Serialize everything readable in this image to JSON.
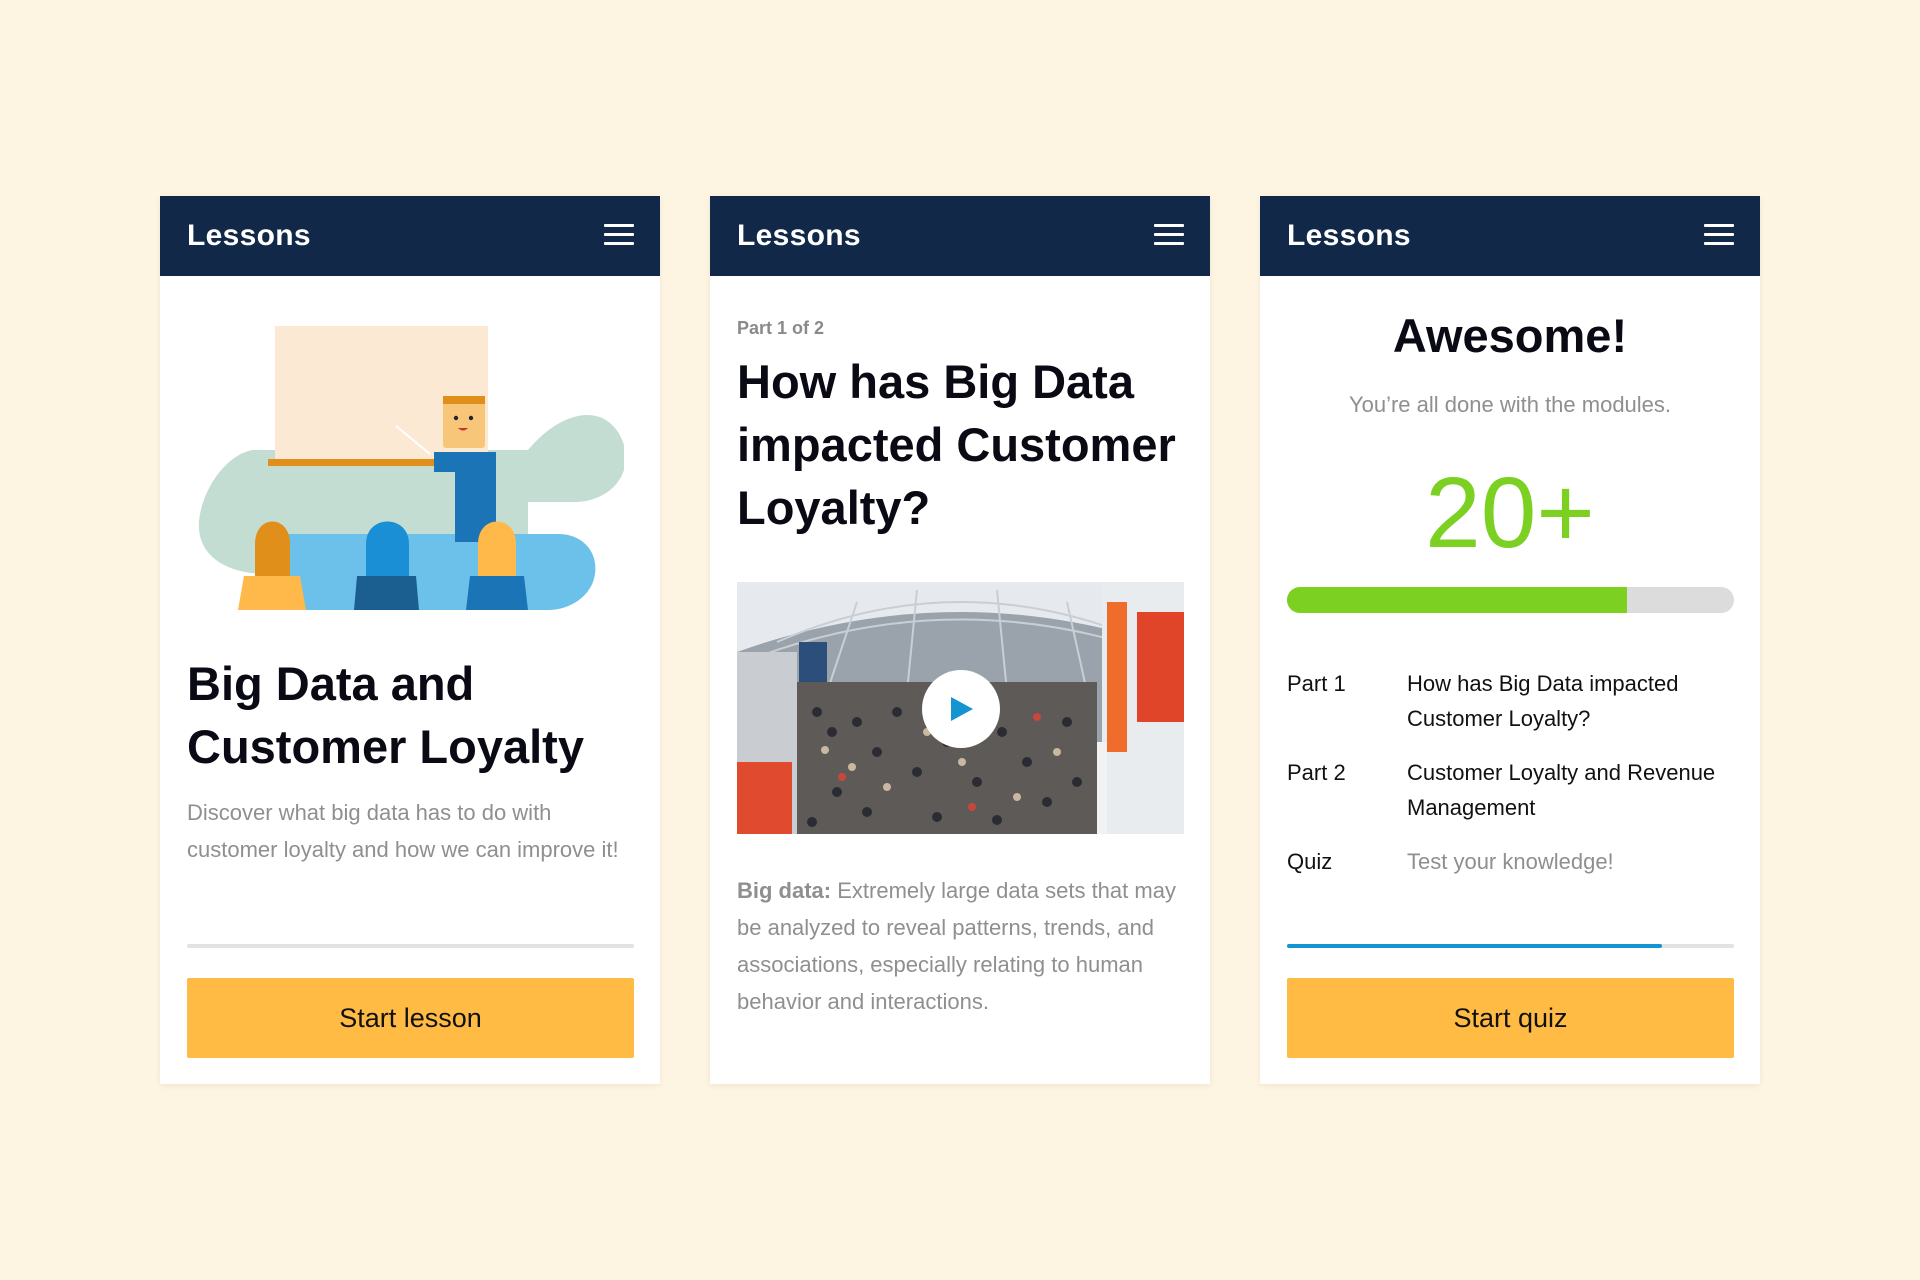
{
  "colors": {
    "background": "#fdf5e1",
    "header": "#112848",
    "accent_button": "#ffbb44",
    "success_green": "#7bd021",
    "progress_blue": "#1594d2",
    "muted_text": "#8f8f8f"
  },
  "screen1": {
    "header_title": "Lessons",
    "menu_icon": "hamburger-menu-icon",
    "illustration": "classroom-teacher-illustration",
    "title": "Big Data and Customer Loyalty",
    "description": "Discover what big data has to do with customer loyalty and how we can improve it!",
    "progress": 0,
    "button_label": "Start lesson"
  },
  "screen2": {
    "header_title": "Lessons",
    "menu_icon": "hamburger-menu-icon",
    "part_label": "Part 1 of 2",
    "title": "How has Big Data impacted Customer Loyalty?",
    "video_icon": "play-icon",
    "definition_term": "Big data:",
    "definition_text": " Extremely large data sets that may be analyzed to reveal patterns, trends, and associations, especially relating to human behavior and interactions."
  },
  "screen3": {
    "header_title": "Lessons",
    "menu_icon": "hamburger-menu-icon",
    "title": "Awesome!",
    "subtitle": "You’re all done with the modules.",
    "score": "20+",
    "score_progress": 0.76,
    "modules": [
      {
        "part": "Part 1",
        "title": "How has Big Data impacted Customer Loyalty?"
      },
      {
        "part": "Part 2",
        "title": "Customer Loyalty and Revenue Management"
      },
      {
        "part": "Quiz",
        "title": "Test your knowledge!"
      }
    ],
    "progress": 0.84,
    "button_label": "Start quiz"
  }
}
